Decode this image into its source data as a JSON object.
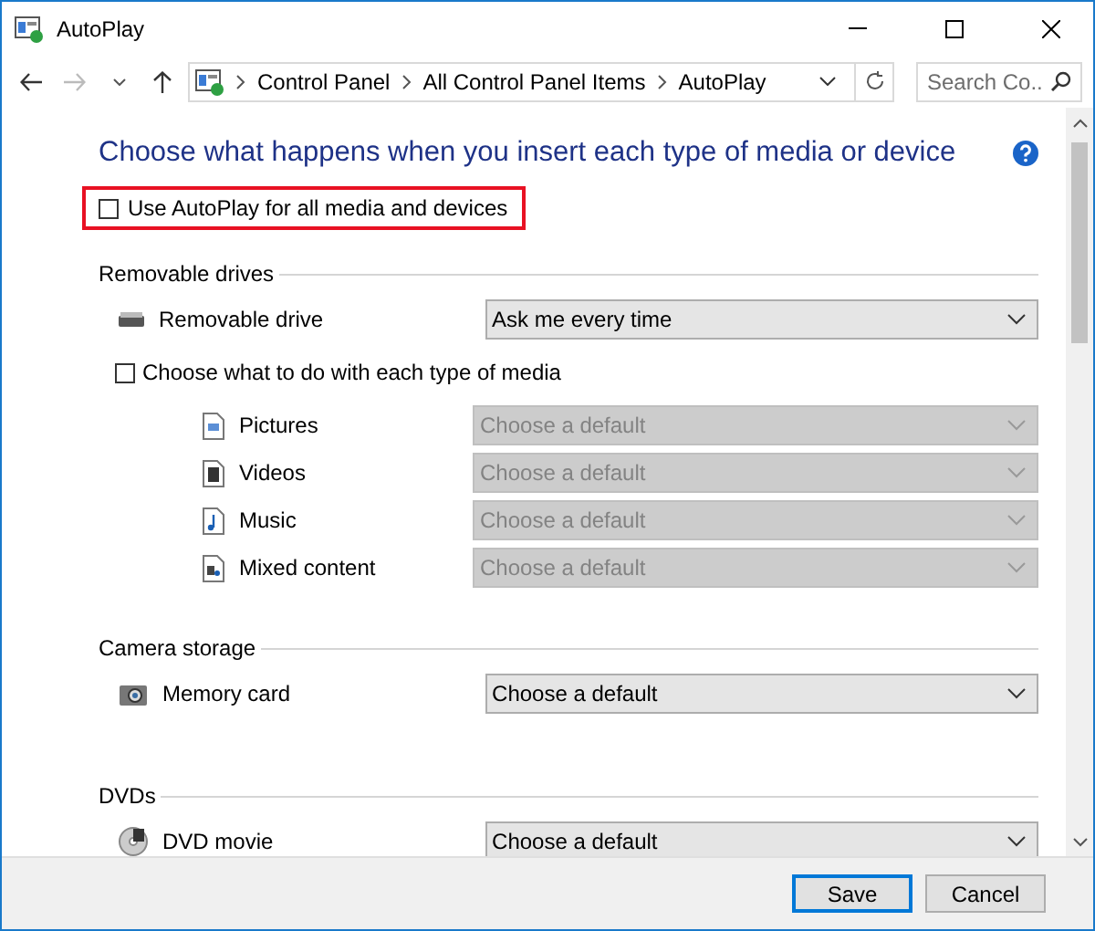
{
  "window": {
    "title": "AutoPlay"
  },
  "address_bar": {
    "path": [
      "Control Panel",
      "All Control Panel Items",
      "AutoPlay"
    ],
    "search": {
      "placeholder": "Search Co..."
    }
  },
  "heading": "Choose what happens when you insert each type of media or device",
  "use_autoplay": {
    "label": "Use AutoPlay for all media and devices",
    "checked": false,
    "highlighted": true
  },
  "sections": [
    {
      "title": "Removable drives",
      "rows": [
        {
          "kind": "dropdown",
          "label": "Removable drive",
          "value": "Ask me every time",
          "disabled": false
        },
        {
          "kind": "checkbox",
          "label": "Choose what to do with each type of media",
          "checked": false,
          "children": [
            {
              "kind": "dropdown",
              "label": "Pictures",
              "value": "Choose a default",
              "disabled": true
            },
            {
              "kind": "dropdown",
              "label": "Videos",
              "value": "Choose a default",
              "disabled": true
            },
            {
              "kind": "dropdown",
              "label": "Music",
              "value": "Choose a default",
              "disabled": true
            },
            {
              "kind": "dropdown",
              "label": "Mixed content",
              "value": "Choose a default",
              "disabled": true
            }
          ]
        }
      ]
    },
    {
      "title": "Camera storage",
      "rows": [
        {
          "kind": "dropdown",
          "label": "Memory card",
          "value": "Choose a default",
          "disabled": false
        }
      ]
    },
    {
      "title": "DVDs",
      "rows": [
        {
          "kind": "dropdown",
          "label": "DVD movie",
          "value": "Choose a default",
          "disabled": false
        }
      ]
    }
  ],
  "buttons": [
    {
      "label": "Save",
      "focused": true
    },
    {
      "label": "Cancel",
      "focused": false
    }
  ]
}
